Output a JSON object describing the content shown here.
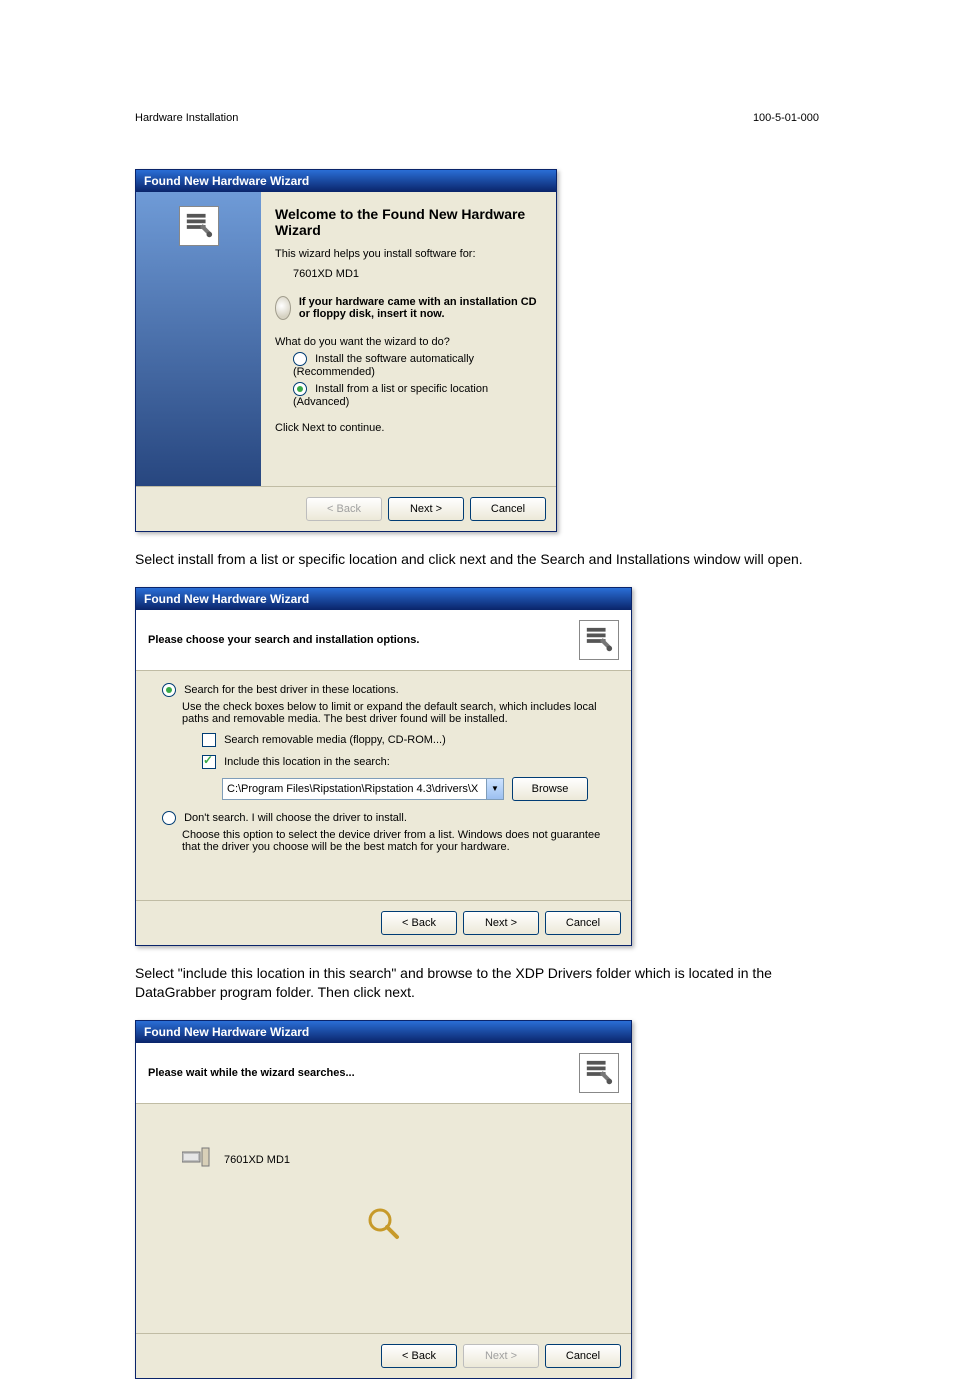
{
  "header": {
    "left": "Hardware Installation",
    "right": "100-5-01-000"
  },
  "para1": "Select install from a list or specific location and click next and the Search and Installations window will open.",
  "para2": "Select \"include this location in this search\" and browse to the XDP Drivers folder which is located in the DataGrabber program folder. Then click next.",
  "d1": {
    "title": "Found New Hardware Wizard",
    "welcome": "Welcome to the Found New Hardware Wizard",
    "intro": "This wizard helps you install software for:",
    "device": "7601XD MD1",
    "cd_notice": "If your hardware came with an installation CD or floppy disk, insert it now.",
    "question": "What do you want the wizard to do?",
    "opt_auto": "Install the software automatically (Recommended)",
    "opt_list": "Install from a list or specific location (Advanced)",
    "continue": "Click Next to continue.",
    "back": "< Back",
    "next": "Next >",
    "cancel": "Cancel"
  },
  "d2": {
    "title": "Found New Hardware Wizard",
    "header": "Please choose your search and installation options.",
    "opt_search": "Search for the best driver in these locations.",
    "search_desc": "Use the check boxes below to limit or expand the default search, which includes local paths and removable media. The best driver found will be installed.",
    "chk_removable": "Search removable media (floppy, CD-ROM...)",
    "chk_include": "Include this location in the search:",
    "path": "C:\\Program Files\\Ripstation\\Ripstation 4.3\\drivers\\X",
    "browse": "Browse",
    "opt_dont": "Don't search. I will choose the driver to install.",
    "dont_desc": "Choose this option to select the device driver from a list.  Windows does not guarantee that the driver you choose will be the best match for your hardware.",
    "back": "< Back",
    "next": "Next >",
    "cancel": "Cancel"
  },
  "d3": {
    "title": "Found New Hardware Wizard",
    "header": "Please wait while the wizard searches...",
    "device": "7601XD MD1",
    "back": "< Back",
    "next": "Next >",
    "cancel": "Cancel"
  },
  "icons": {
    "wizard": "wizard-icon",
    "cd": "cd-icon",
    "search_glass": "magnifier-icon",
    "device": "hardware-icon"
  }
}
